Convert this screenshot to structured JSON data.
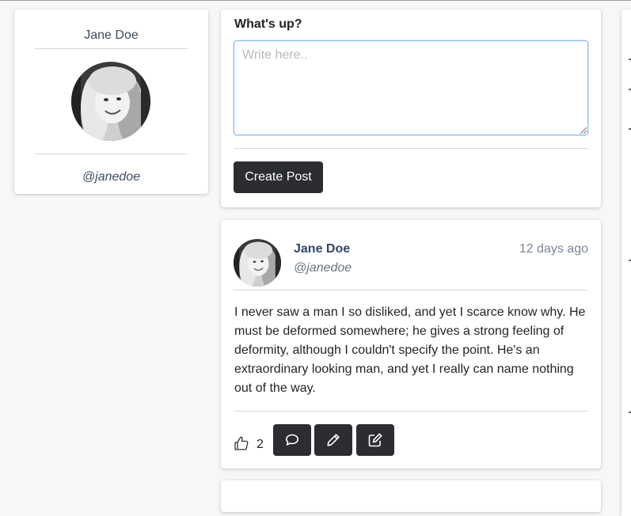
{
  "profile": {
    "name": "Jane Doe",
    "handle": "@janedoe",
    "avatar_icon": "user-avatar-photo"
  },
  "compose": {
    "label": "What's up?",
    "placeholder": "Write here..",
    "value": "",
    "submit_label": "Create Post"
  },
  "posts": [
    {
      "author": "Jane Doe",
      "handle": "@janedoe",
      "time": "12 days ago",
      "body": "I never saw a man I so disliked, and yet I scarce know why. He must be deformed somewhere; he gives a strong feeling of deformity, although I couldn't specify the point. He's an extraordinary looking man, and yet I really can name nothing out of the way.",
      "likes": "2",
      "icons": {
        "like": "thumbs-up-icon",
        "comment": "speech-bubble-icon",
        "edit": "pencil-icon",
        "write": "pencil-square-icon"
      }
    }
  ],
  "colors": {
    "button_dark": "#2b2d31",
    "author_link": "#2f4668",
    "focus_border": "#86b7fe",
    "page_bg": "#f7f7f7"
  }
}
